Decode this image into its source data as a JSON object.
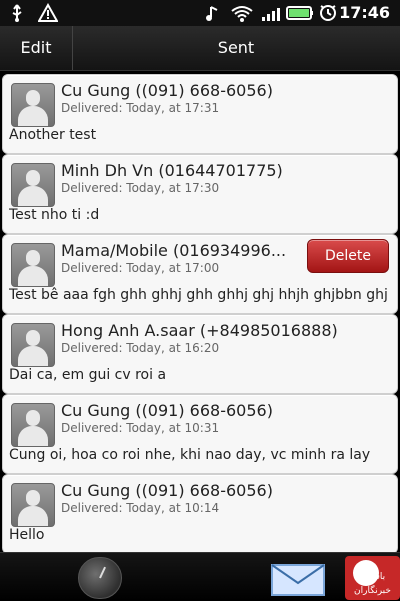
{
  "status_bar": {
    "time": "17:46",
    "icons": [
      "usb-icon",
      "warning-icon",
      "music-icon",
      "wifi-icon",
      "signal-icon",
      "battery-icon",
      "alarm-icon"
    ]
  },
  "header": {
    "edit_label": "Edit",
    "title": "Sent"
  },
  "messages": [
    {
      "name": "Cu Gung ((091) 668-6056)",
      "status": "Delivered: Today, at 17:31",
      "text": "Another test"
    },
    {
      "name": "Minh Dh Vn (01644701775)",
      "status": "Delivered: Today, at 17:30",
      "text": "Test nho ti :d"
    },
    {
      "name": "Mama/Mobile (016934996...",
      "status": "Delivered: Today, at 17:00",
      "text": "Test bê aaa fgh ghh ghhj ghh ghhj ghj hhjh ghjbbn ghj ...",
      "action_label": "Delete"
    },
    {
      "name": "Hong Anh A.saar (+84985016888)",
      "status": "Delivered: Today, at 16:20",
      "text": "Dai ca, em gui cv roi a"
    },
    {
      "name": "Cu Gung ((091) 668-6056)",
      "status": "Delivered: Today, at 10:31",
      "text": "Cung oi, hoa co roi nhe, khi nao day, vc minh ra lay"
    },
    {
      "name": "Cu Gung ((091) 668-6056)",
      "status": "Delivered: Today, at 10:14",
      "text": "Hello"
    }
  ],
  "bottom_bar": {
    "left_icon": "clock-icon",
    "right_icon": "envelope-icon"
  },
  "watermark": {
    "text": "باشگاه خبرنگاران"
  },
  "colors": {
    "delete_button": "#b71c1c",
    "watermark": "#c62828"
  }
}
